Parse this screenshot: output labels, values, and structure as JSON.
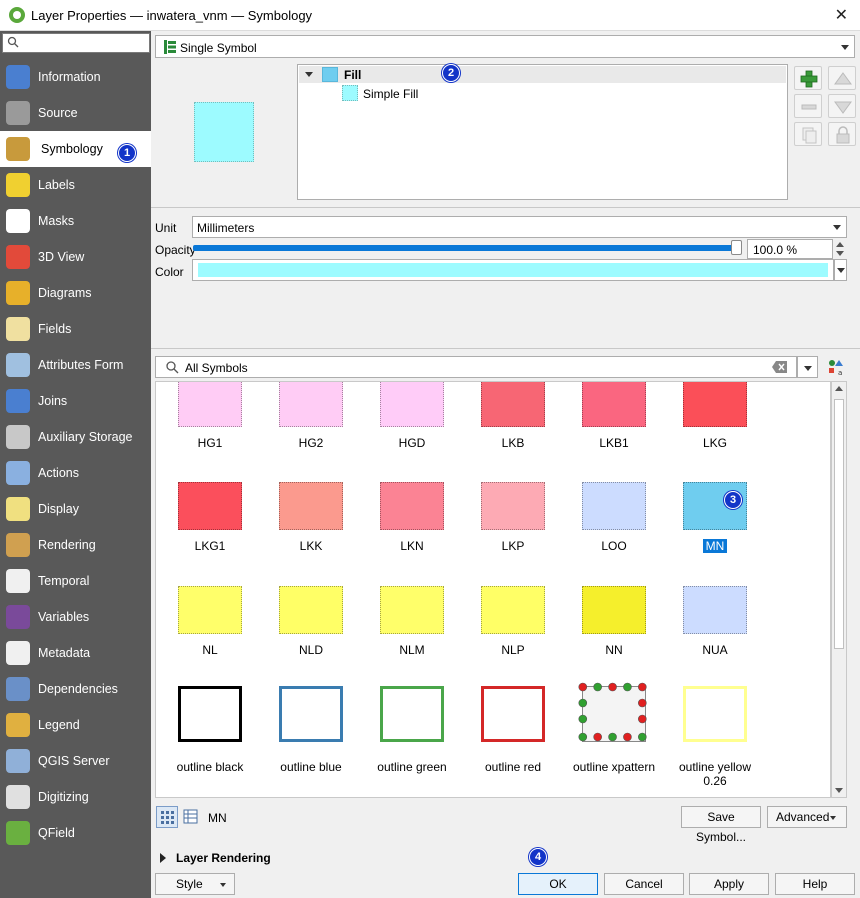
{
  "window": {
    "title": "Layer Properties — inwatera_vnm — Symbology",
    "close": "✕"
  },
  "sidebar": {
    "search_placeholder": "",
    "items": [
      {
        "label": "Information",
        "icon": "information-icon",
        "color": "#4a7fd0"
      },
      {
        "label": "Source",
        "icon": "source-icon",
        "color": "#9a9a9a"
      },
      {
        "label": "Symbology",
        "icon": "symbology-icon",
        "color": "#c89a3c"
      },
      {
        "label": "Labels",
        "icon": "labels-icon",
        "color": "#f0d030"
      },
      {
        "label": "Masks",
        "icon": "masks-icon",
        "color": "#ffffff"
      },
      {
        "label": "3D View",
        "icon": "3d-view-icon",
        "color": "#e24a3a"
      },
      {
        "label": "Diagrams",
        "icon": "diagrams-icon",
        "color": "#e7b02a"
      },
      {
        "label": "Fields",
        "icon": "fields-icon",
        "color": "#f0e0a0"
      },
      {
        "label": "Attributes Form",
        "icon": "attributes-form-icon",
        "color": "#a0c0e0"
      },
      {
        "label": "Joins",
        "icon": "joins-icon",
        "color": "#4a7fd0"
      },
      {
        "label": "Auxiliary Storage",
        "icon": "auxiliary-storage-icon",
        "color": "#c8c8c8"
      },
      {
        "label": "Actions",
        "icon": "actions-icon",
        "color": "#8ab0e0"
      },
      {
        "label": "Display",
        "icon": "display-icon",
        "color": "#f0e080"
      },
      {
        "label": "Rendering",
        "icon": "rendering-icon",
        "color": "#d0a050"
      },
      {
        "label": "Temporal",
        "icon": "temporal-icon",
        "color": "#f0f0f0"
      },
      {
        "label": "Variables",
        "icon": "variables-icon",
        "color": "#7a4a9a"
      },
      {
        "label": "Metadata",
        "icon": "metadata-icon",
        "color": "#f0f0f0"
      },
      {
        "label": "Dependencies",
        "icon": "dependencies-icon",
        "color": "#6a90c8"
      },
      {
        "label": "Legend",
        "icon": "legend-icon",
        "color": "#e0b040"
      },
      {
        "label": "QGIS Server",
        "icon": "qgis-server-icon",
        "color": "#90b0d8"
      },
      {
        "label": "Digitizing",
        "icon": "digitizing-icon",
        "color": "#e0e0e0"
      },
      {
        "label": "QField",
        "icon": "qfield-icon",
        "color": "#6ab040"
      }
    ]
  },
  "badges": [
    "1",
    "2",
    "3",
    "4"
  ],
  "renderer": {
    "value": "Single Symbol"
  },
  "symbol_tree": {
    "root": "Fill",
    "child": "Simple Fill"
  },
  "settings": {
    "unit_label": "Unit",
    "unit_value": "Millimeters",
    "opacity_label": "Opacity",
    "opacity_value": "100.0 %",
    "opacity_level": 1.0,
    "color_label": "Color",
    "color_value": "#9dfbff"
  },
  "library": {
    "search_value": "All Symbols",
    "symbols": [
      {
        "name": "HG1",
        "fill": "#ffccf5"
      },
      {
        "name": "HG2",
        "fill": "#ffccf5"
      },
      {
        "name": "HGD",
        "fill": "#ffccf8"
      },
      {
        "name": "LKB",
        "fill": "#f76674"
      },
      {
        "name": "LKB1",
        "fill": "#fa6680"
      },
      {
        "name": "LKG",
        "fill": "#fb4f58"
      },
      {
        "name": "LKG1",
        "fill": "#fb4f5c"
      },
      {
        "name": "LKK",
        "fill": "#fb9a8e"
      },
      {
        "name": "LKN",
        "fill": "#fb8394"
      },
      {
        "name": "LKP",
        "fill": "#fdaab4"
      },
      {
        "name": "LOO",
        "fill": "#ccdcff"
      },
      {
        "name": "MN",
        "fill": "#6fcdef"
      },
      {
        "name": "NL",
        "fill": "#ffff6a"
      },
      {
        "name": "NLD",
        "fill": "#ffff66"
      },
      {
        "name": "NLM",
        "fill": "#ffff6a"
      },
      {
        "name": "NLP",
        "fill": "#ffff66"
      },
      {
        "name": "NN",
        "fill": "#f5ef2c"
      },
      {
        "name": "NUA",
        "fill": "#ccdcff"
      },
      {
        "name": "outline black",
        "stroke": "#000000"
      },
      {
        "name": "outline blue",
        "stroke": "#3a7cb0"
      },
      {
        "name": "outline green",
        "stroke": "#4aa64a"
      },
      {
        "name": "outline red",
        "stroke": "#d42828"
      },
      {
        "name": "outline xpattern",
        "stroke": "#888888"
      },
      {
        "name": "outline yellow",
        "name2": "0.26",
        "stroke": "#ffff90"
      }
    ],
    "selected": "MN",
    "selected_label": "MN",
    "save_symbol": "Save Symbol...",
    "advanced": "Advanced"
  },
  "layer_rendering": "Layer Rendering",
  "footer": {
    "style": "Style",
    "ok": "OK",
    "cancel": "Cancel",
    "apply": "Apply",
    "help": "Help"
  }
}
